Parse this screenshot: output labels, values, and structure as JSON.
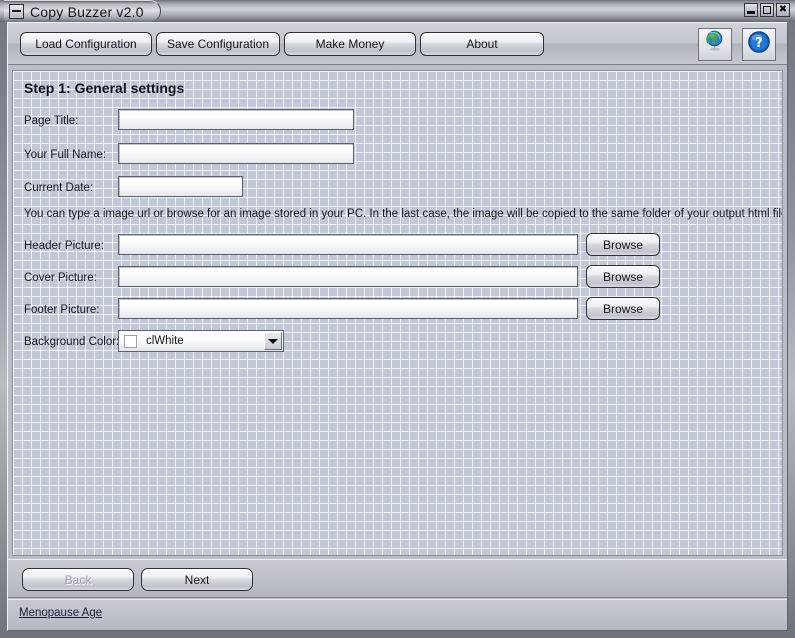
{
  "window": {
    "title": "Copy Buzzer v2.0",
    "sysmenu_icon": "system-menu-icon",
    "controls": {
      "minimize": "minimize-icon",
      "maximize": "maximize-icon",
      "close": "✖"
    }
  },
  "toolbar": {
    "buttons": [
      {
        "label": "Load Configuration"
      },
      {
        "label": "Save Configuration"
      },
      {
        "label": "Make Money"
      },
      {
        "label": "About"
      }
    ],
    "icons": [
      {
        "name": "globe-icon"
      },
      {
        "name": "help-icon",
        "glyph": "?"
      }
    ]
  },
  "main": {
    "step_title": "Step 1: General settings",
    "hint": "You can type a image url or browse for an image stored in your PC. In the last case, the image will be copied to the same folder of your output html file.",
    "fields": {
      "page_title": {
        "label": "Page Title:",
        "value": "",
        "placeholder": ""
      },
      "full_name": {
        "label": "Your Full Name:",
        "value": "",
        "placeholder": ""
      },
      "current_date": {
        "label": "Current Date:",
        "value": "",
        "placeholder": ""
      },
      "header_picture": {
        "label": "Header Picture:",
        "value": "",
        "placeholder": "",
        "browse_label": "Browse"
      },
      "cover_picture": {
        "label": "Cover Picture:",
        "value": "",
        "placeholder": "",
        "browse_label": "Browse"
      },
      "footer_picture": {
        "label": "Footer Picture:",
        "value": "",
        "placeholder": "",
        "browse_label": "Browse"
      },
      "background_color": {
        "label": "Background Color:",
        "value": "clWhite",
        "swatch": "#ffffff"
      }
    }
  },
  "nav": {
    "back_label": "Back",
    "next_label": "Next"
  },
  "status": {
    "link_label": "Menopause Age"
  },
  "colors": {
    "client_background": "#c3c8d6",
    "grid_line": "#ffffff",
    "chrome": "#bdc1c8",
    "field_border": "#5b6070",
    "text": "#15181f"
  }
}
